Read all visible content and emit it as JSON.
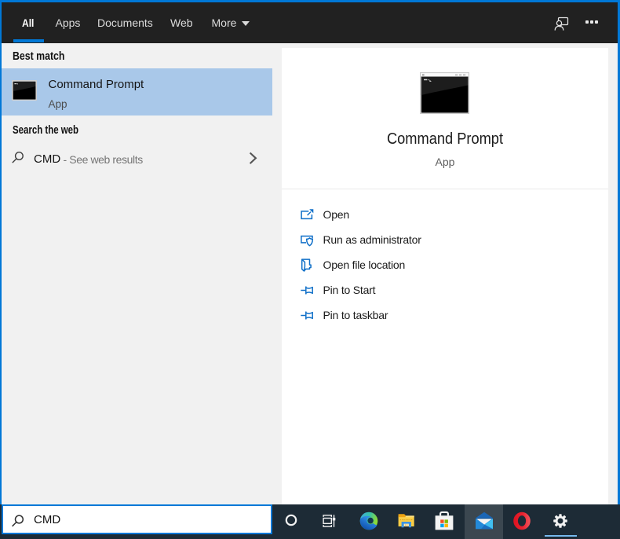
{
  "tabs": {
    "items": [
      {
        "label": "All",
        "active": true
      },
      {
        "label": "Apps",
        "active": false
      },
      {
        "label": "Documents",
        "active": false
      },
      {
        "label": "Web",
        "active": false
      },
      {
        "label": "More",
        "active": false,
        "has_dropdown": true
      }
    ],
    "icons": [
      "user-feedback-icon",
      "ellipsis-icon"
    ]
  },
  "left_pane": {
    "best_match_header": "Best match",
    "best_match": {
      "title": "Command Prompt",
      "subtitle": "App",
      "icon": "command-prompt-icon",
      "selected": true
    },
    "web_header": "Search the web",
    "web_row": {
      "query": "CMD",
      "hint": "- See web results",
      "icon": "search-icon",
      "chevron": "chevron-right-icon"
    }
  },
  "preview": {
    "icon": "command-prompt-icon",
    "title": "Command Prompt",
    "subtitle": "App",
    "actions": [
      {
        "icon": "open-icon",
        "label": "Open"
      },
      {
        "icon": "run-as-admin-icon",
        "label": "Run as administrator"
      },
      {
        "icon": "file-location-icon",
        "label": "Open file location"
      },
      {
        "icon": "pin-to-start-icon",
        "label": "Pin to Start"
      },
      {
        "icon": "pin-to-taskbar-icon",
        "label": "Pin to taskbar"
      }
    ]
  },
  "search_box": {
    "value": "CMD",
    "icon": "search-icon"
  },
  "taskbar": {
    "apps": [
      {
        "name": "cortana",
        "icon": "cortana-icon"
      },
      {
        "name": "task-view",
        "icon": "task-view-icon"
      },
      {
        "name": "edge",
        "icon": "edge-icon"
      },
      {
        "name": "file-explorer",
        "icon": "file-explorer-icon"
      },
      {
        "name": "store",
        "icon": "microsoft-store-icon"
      },
      {
        "name": "mail",
        "icon": "mail-icon",
        "highlighted": true
      },
      {
        "name": "opera",
        "icon": "opera-icon"
      },
      {
        "name": "settings",
        "icon": "settings-icon",
        "running": true
      }
    ]
  },
  "colors": {
    "accent": "#0078d7",
    "topbar_bg": "#212121",
    "left_pane_bg": "#f1f1f1",
    "selected_row_bg": "#a9c8e9",
    "card_bg": "#ffffff",
    "taskbar_bg": "#1d2b36",
    "action_icon_blue": "#0f6fc8",
    "run_indicator": "#76b9ed"
  }
}
